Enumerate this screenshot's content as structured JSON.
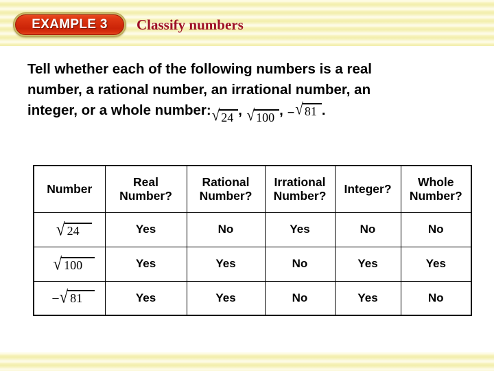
{
  "header": {
    "badge_label": "EXAMPLE 3",
    "title": "Classify numbers",
    "badge_color": "#d32c0c",
    "badge_ring_color": "#c9b96a",
    "title_color": "#9e1126"
  },
  "background": {
    "band_color": "#f7f4c4",
    "content_color": "#ffffff"
  },
  "prompt": {
    "line1": "Tell whether each of the following numbers is a real",
    "line2": "number, a rational number, an irrational number, an",
    "line3_prefix": "integer, or a whole number:",
    "radicals": [
      {
        "sign": "√",
        "radicand": "24",
        "negative": ""
      },
      {
        "sign": "√",
        "radicand": "100",
        "negative": ""
      },
      {
        "sign": "√",
        "radicand": "81",
        "negative": "−"
      }
    ],
    "separator1": ",",
    "separator2": ",",
    "terminator": "."
  },
  "table": {
    "headers": [
      {
        "line1": "Number",
        "line2": ""
      },
      {
        "line1": "Real",
        "line2": "Number?"
      },
      {
        "line1": "Rational",
        "line2": "Number?"
      },
      {
        "line1": "Irrational",
        "line2": "Number?"
      },
      {
        "line1": "Integer?",
        "line2": ""
      },
      {
        "line1": "Whole",
        "line2": "Number?"
      }
    ],
    "rows": [
      {
        "number": {
          "sign": "√",
          "radicand": "24",
          "negative": ""
        },
        "real": "Yes",
        "rational": "No",
        "irrational": "Yes",
        "integer": "No",
        "whole": "No"
      },
      {
        "number": {
          "sign": "√",
          "radicand": "100",
          "negative": ""
        },
        "real": "Yes",
        "rational": "Yes",
        "irrational": "No",
        "integer": "Yes",
        "whole": "Yes"
      },
      {
        "number": {
          "sign": "√",
          "radicand": "81",
          "negative": "–"
        },
        "real": "Yes",
        "rational": "Yes",
        "irrational": "No",
        "integer": "Yes",
        "whole": "No"
      }
    ]
  }
}
